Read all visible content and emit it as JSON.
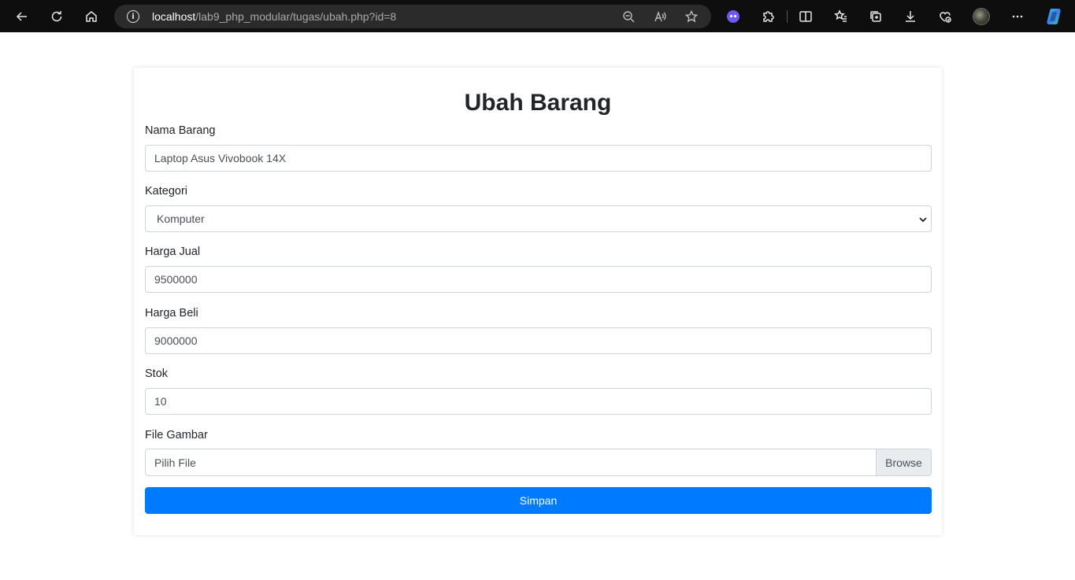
{
  "browser": {
    "url_host": "localhost",
    "url_path": "/lab9_php_modular/tugas/ubah.php?id=8"
  },
  "page": {
    "title": "Ubah Barang",
    "fields": {
      "nama_barang": {
        "label": "Nama Barang",
        "value": "Laptop Asus Vivobook 14X"
      },
      "kategori": {
        "label": "Kategori",
        "value": "Komputer"
      },
      "harga_jual": {
        "label": "Harga Jual",
        "value": "9500000"
      },
      "harga_beli": {
        "label": "Harga Beli",
        "value": "9000000"
      },
      "stok": {
        "label": "Stok",
        "value": "10"
      },
      "file_gambar": {
        "label": "File Gambar",
        "placeholder": "Pilih File",
        "browse_label": "Browse"
      }
    },
    "submit_label": "Simpan"
  },
  "colors": {
    "primary": "#007bff",
    "chrome_bg": "#0e0e0e",
    "addressbar_bg": "#2b2b2b"
  },
  "icons": [
    "back-icon",
    "refresh-icon",
    "home-icon",
    "info-icon",
    "zoom-out-icon",
    "read-aloud-icon",
    "favorite-star-icon",
    "extension-ghost-icon",
    "extensions-puzzle-icon",
    "split-screen-icon",
    "favorites-icon",
    "collections-icon",
    "download-icon",
    "browser-essentials-icon",
    "profile-avatar",
    "more-menu-icon",
    "copilot-icon",
    "chevron-down-icon"
  ]
}
